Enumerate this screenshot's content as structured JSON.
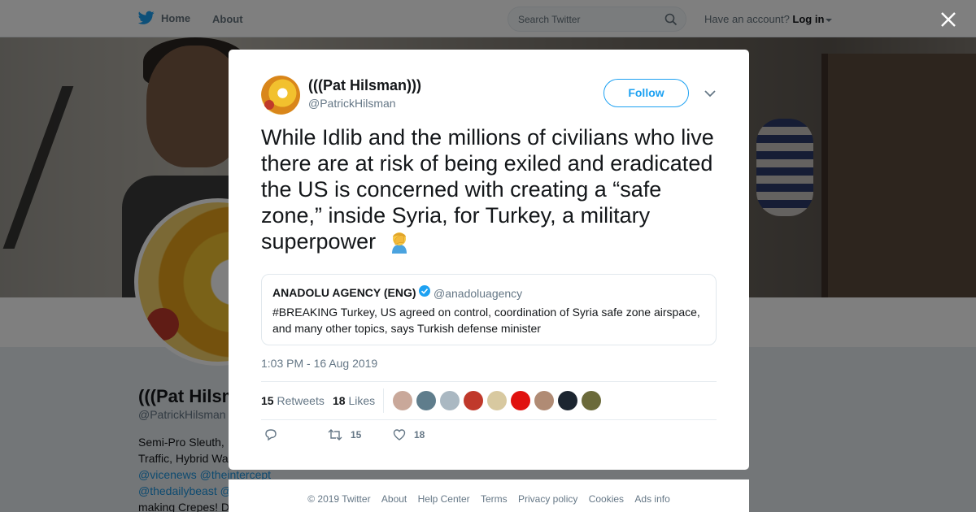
{
  "topbar": {
    "home_label": "Home",
    "about_label": "About",
    "search_placeholder": "Search Twitter",
    "account_prompt": "Have an account?",
    "login_label": "Log in"
  },
  "background_profile": {
    "name": "(((Pat Hilsm",
    "handle": "@PatrickHilsman",
    "bio_lines": [
      "Semi-Pro Sleuth, .",
      "Traffic, Hybrid Wa"
    ],
    "bio_links": [
      "@vicenews @theintercept",
      "@thedailybeast @"
    ],
    "bio_tail": "making Crepes! D"
  },
  "tweet": {
    "author_name": "(((Pat Hilsman)))",
    "author_handle": "@PatrickHilsman",
    "follow_label": "Follow",
    "text": "While Idlib and the millions of civilians who live there are at risk of being exiled and eradicated the US is concerned with creating a “safe zone,” inside Syria, for Turkey, a military superpower",
    "emoji_icon": "facepalm-emoji",
    "quoted": {
      "name": "ANADOLU AGENCY (ENG)",
      "handle": "@anadoluagency",
      "verified": true,
      "text": "#BREAKING Turkey, US agreed on control, coordination of Syria safe zone airspace, and many other topics, says Turkish defense minister"
    },
    "timestamp": "1:03 PM - 16 Aug 2019",
    "retweets_count": "15",
    "retweets_label": "Retweets",
    "likes_count": "18",
    "likes_label": "Likes",
    "liker_colors": [
      "#c9a89a",
      "#5f7d8c",
      "#aab8c2",
      "#c0392b",
      "#d8c9a0",
      "#e0120f",
      "#b08b74",
      "#1c2530",
      "#6b6a3a"
    ],
    "actions": {
      "reply_count": "",
      "retweet_count": "15",
      "like_count": "18"
    }
  },
  "footer": {
    "links": [
      "© 2019 Twitter",
      "About",
      "Help Center",
      "Terms",
      "Privacy policy",
      "Cookies",
      "Ads info"
    ]
  },
  "colors": {
    "twitter_blue": "#1da1f2",
    "text_primary": "#14171a",
    "text_secondary": "#657786"
  }
}
